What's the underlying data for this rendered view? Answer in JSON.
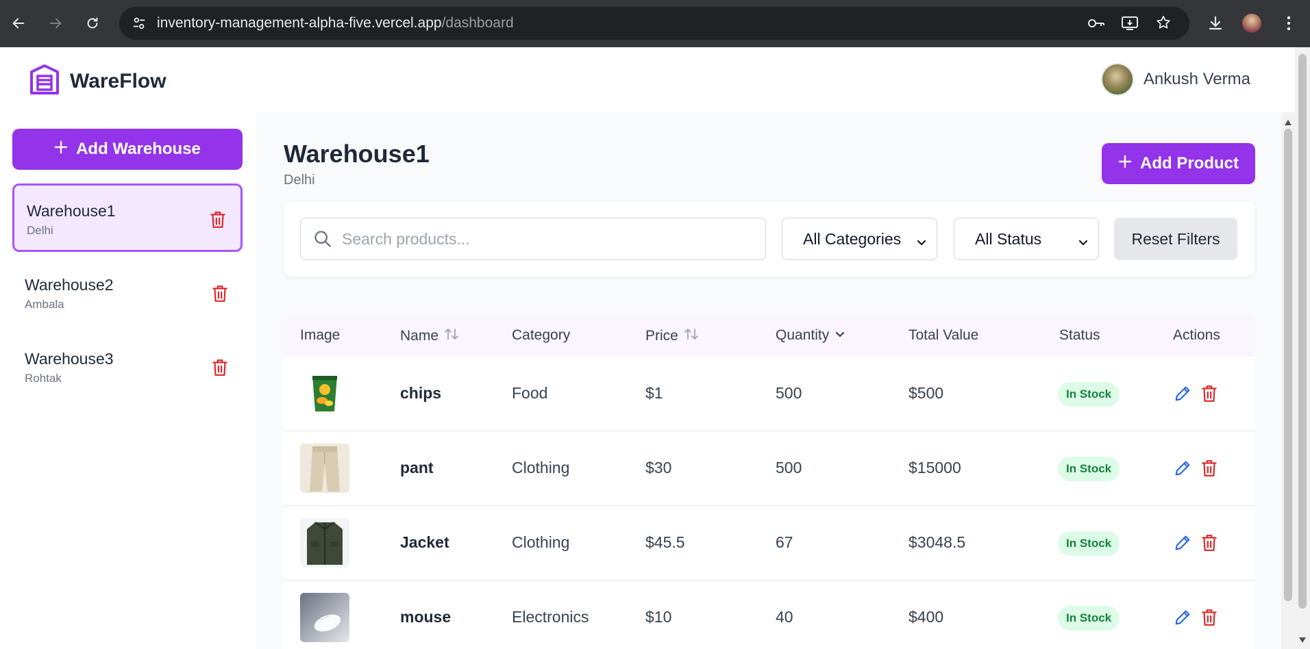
{
  "browser": {
    "url_host": "inventory-management-alpha-five.vercel.app",
    "url_path": "/dashboard"
  },
  "brand": {
    "name": "WareFlow",
    "accent": "#9333ea"
  },
  "user": {
    "name": "Ankush Verma"
  },
  "sidebar": {
    "add_label": "Add Warehouse",
    "warehouses": [
      {
        "name": "Warehouse1",
        "location": "Delhi",
        "active": true
      },
      {
        "name": "Warehouse2",
        "location": "Ambala",
        "active": false
      },
      {
        "name": "Warehouse3",
        "location": "Rohtak",
        "active": false
      }
    ]
  },
  "main": {
    "title": "Warehouse1",
    "subtitle": "Delhi",
    "add_product_label": "Add Product",
    "search_placeholder": "Search products...",
    "category_selected": "All Categories",
    "status_selected": "All Status",
    "reset_label": "Reset Filters"
  },
  "table": {
    "headers": [
      "Image",
      "Name",
      "Category",
      "Price",
      "Quantity",
      "Total Value",
      "Status",
      "Actions"
    ],
    "rows": [
      {
        "name": "chips",
        "category": "Food",
        "price": "$1",
        "quantity": "500",
        "total": "$500",
        "status": "In Stock"
      },
      {
        "name": "pant",
        "category": "Clothing",
        "price": "$30",
        "quantity": "500",
        "total": "$15000",
        "status": "In Stock"
      },
      {
        "name": "Jacket",
        "category": "Clothing",
        "price": "$45.5",
        "quantity": "67",
        "total": "$3048.5",
        "status": "In Stock"
      },
      {
        "name": "mouse",
        "category": "Electronics",
        "price": "$10",
        "quantity": "40",
        "total": "$400",
        "status": "In Stock"
      }
    ]
  }
}
